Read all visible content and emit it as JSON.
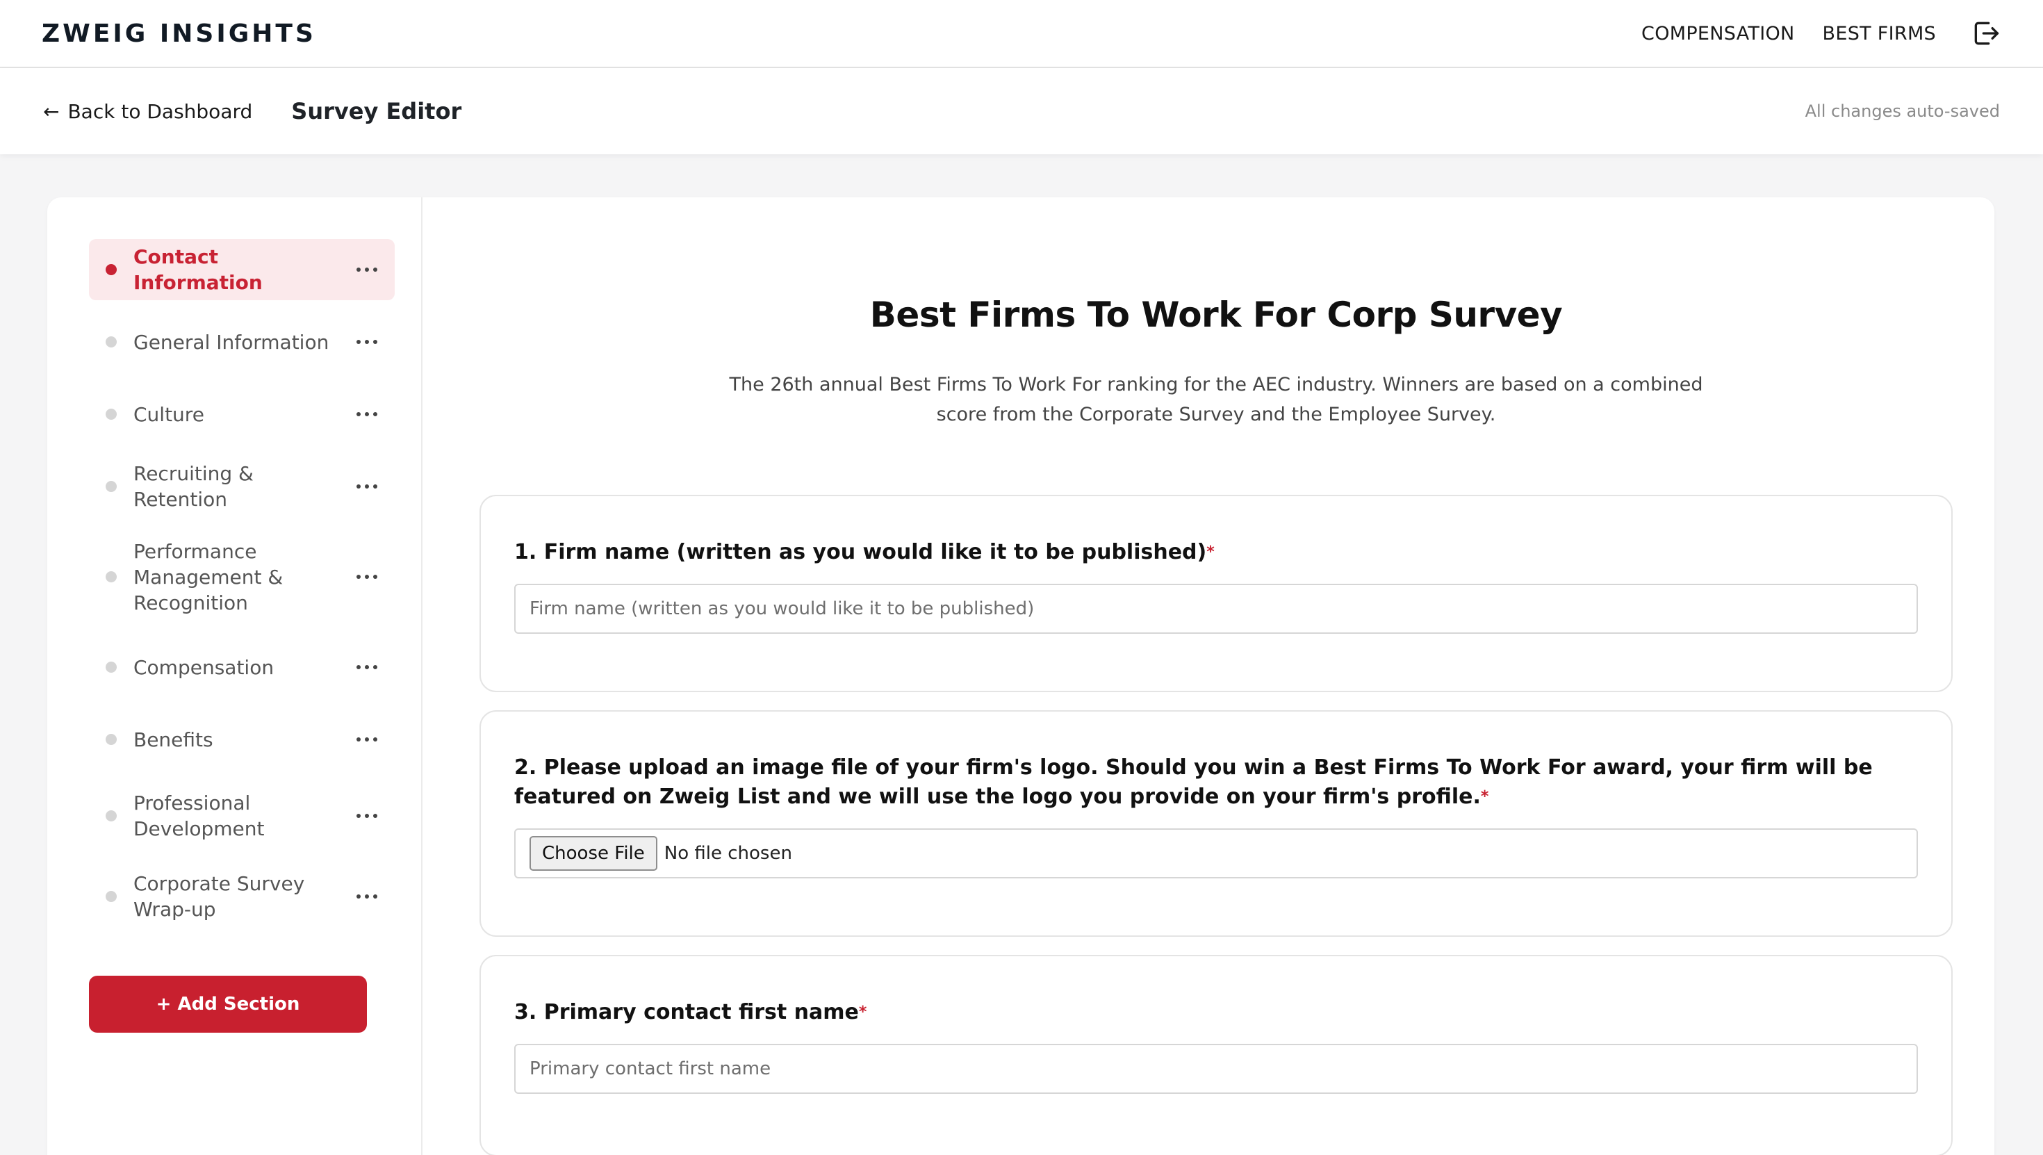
{
  "brand": {
    "logo_text": "ZWEIG INSIGHTS"
  },
  "topnav": {
    "items": [
      {
        "label": "COMPENSATION"
      },
      {
        "label": "BEST FIRMS"
      }
    ],
    "logout_icon": "logout-icon"
  },
  "subheader": {
    "back_label": "Back to Dashboard",
    "title": "Survey Editor",
    "status": "All changes auto-saved"
  },
  "sidebar": {
    "items": [
      {
        "label": "Contact Information",
        "active": true
      },
      {
        "label": "General Information",
        "active": false
      },
      {
        "label": "Culture",
        "active": false
      },
      {
        "label": "Recruiting & Retention",
        "active": false
      },
      {
        "label": "Performance Management & Recognition",
        "active": false
      },
      {
        "label": "Compensation",
        "active": false
      },
      {
        "label": "Benefits",
        "active": false
      },
      {
        "label": "Professional Development",
        "active": false
      },
      {
        "label": "Corporate Survey Wrap-up",
        "active": false
      }
    ],
    "add_label": "+ Add Section"
  },
  "survey": {
    "title": "Best Firms To Work For Corp Survey",
    "description": "The 26th annual Best Firms To Work For ranking for the AEC industry. Winners are based on a combined score from the Corporate Survey and the Employee Survey."
  },
  "questions": [
    {
      "number": "1.",
      "text": "Firm name (written as you would like it to be published)",
      "required": "*",
      "placeholder": "Firm name (written as you would like it to be published)"
    },
    {
      "number": "2.",
      "text": "Please upload an image file of your firm's logo. Should you win a Best Firms To Work For award, your firm will be featured on Zweig List and we will use the logo you provide on your firm's profile.",
      "required": "*",
      "file_button": "Choose File",
      "file_status": "No file chosen"
    },
    {
      "number": "3.",
      "text": "Primary contact first name",
      "required": "*",
      "placeholder": "Primary contact first name"
    }
  ],
  "colors": {
    "accent": "#c8202f",
    "active_bg": "#fbe9eb",
    "page_bg": "#f5f5f6"
  }
}
